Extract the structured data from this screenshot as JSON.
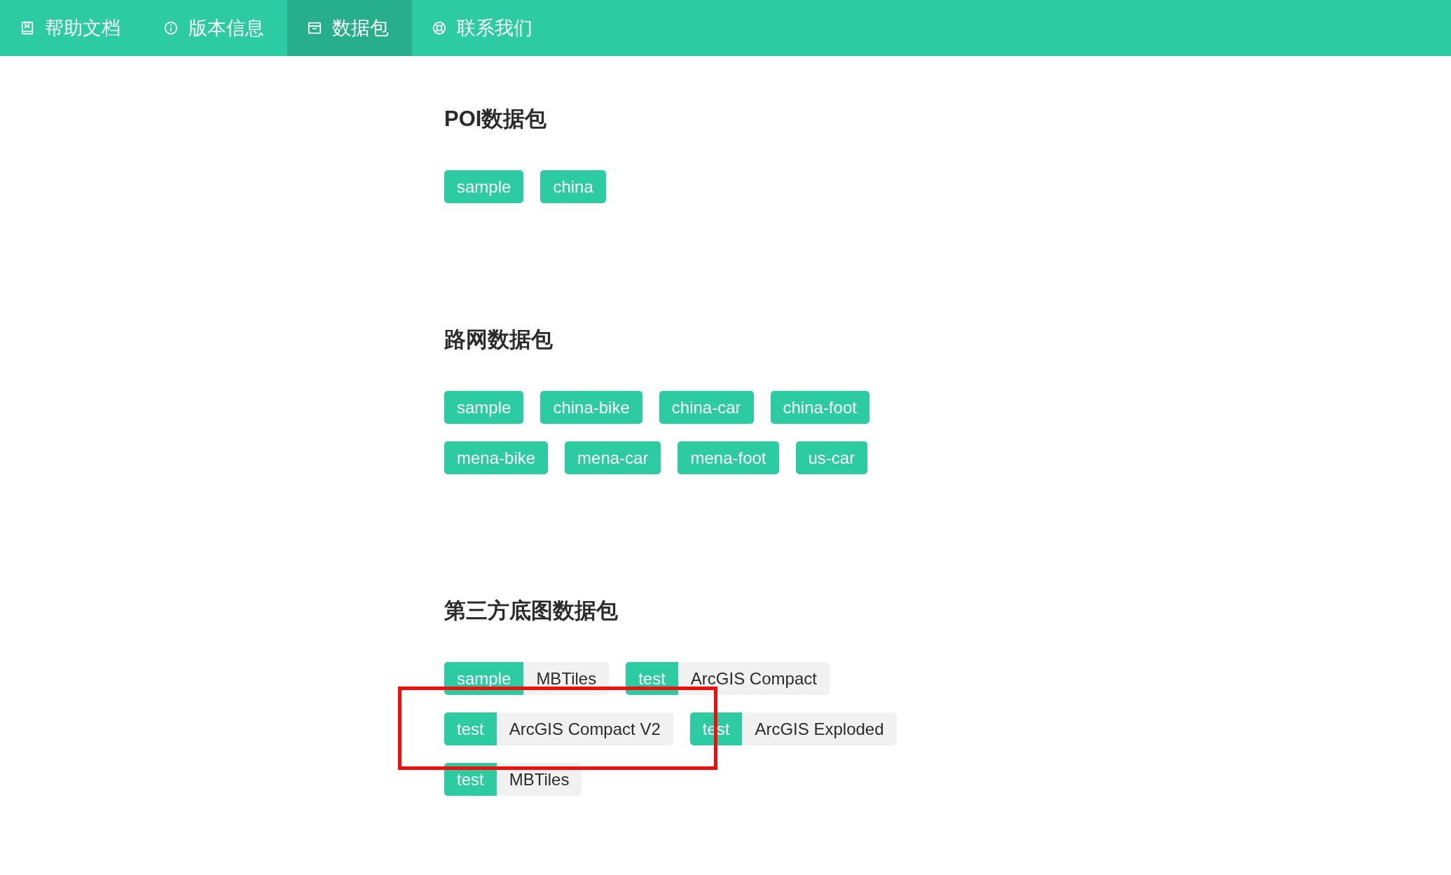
{
  "nav": {
    "items": [
      {
        "label": "帮助文档",
        "selected": false
      },
      {
        "label": "版本信息",
        "selected": false
      },
      {
        "label": "数据包",
        "selected": true
      },
      {
        "label": "联系我们",
        "selected": false
      }
    ]
  },
  "sections": [
    {
      "title": "POI数据包",
      "tags": [
        {
          "kind": "single",
          "label": "sample"
        },
        {
          "kind": "single",
          "label": "china"
        }
      ]
    },
    {
      "title": "路网数据包",
      "tags": [
        {
          "kind": "single",
          "label": "sample"
        },
        {
          "kind": "single",
          "label": "china-bike"
        },
        {
          "kind": "single",
          "label": "china-car"
        },
        {
          "kind": "single",
          "label": "china-foot"
        },
        {
          "kind": "single",
          "label": "mena-bike"
        },
        {
          "kind": "single",
          "label": "mena-car"
        },
        {
          "kind": "single",
          "label": "mena-foot"
        },
        {
          "kind": "single",
          "label": "us-car"
        }
      ]
    },
    {
      "title": "第三方底图数据包",
      "annotations": [
        {
          "kind": "box"
        }
      ],
      "tags": [
        {
          "kind": "pair",
          "label": "sample",
          "value": "MBTiles"
        },
        {
          "kind": "pair",
          "label": "test",
          "value": "ArcGIS Compact"
        },
        {
          "kind": "pair",
          "label": "test",
          "value": "ArcGIS Compact V2"
        },
        {
          "kind": "pair",
          "label": "test",
          "value": "ArcGIS Exploded"
        },
        {
          "kind": "pair",
          "label": "test",
          "value": "MBTiles"
        }
      ]
    }
  ]
}
